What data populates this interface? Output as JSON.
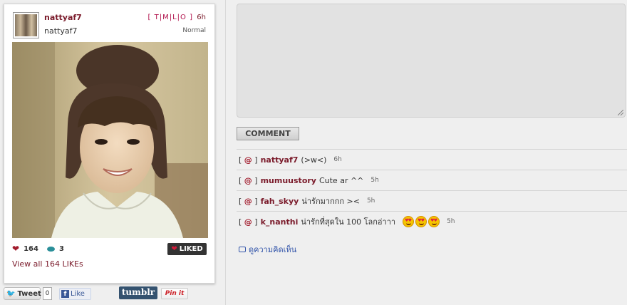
{
  "post": {
    "username": "nattyaf7",
    "display_name": "nattyaf7",
    "share_links": [
      "T",
      "M",
      "L",
      "O"
    ],
    "age": "6h",
    "filter": "Normal",
    "likes_count": "164",
    "comments_count": "3",
    "liked_label": "LIKED",
    "view_all_label": "View all 164 LIKEs"
  },
  "social": {
    "tweet_label": "Tweet",
    "tweet_count": "0",
    "fb_like_label": "Like",
    "tumblr_label": "tumblr",
    "pinit_label": "Pin it"
  },
  "comment_form": {
    "button_label": "COMMENT"
  },
  "comments": [
    {
      "at": "@",
      "user": "nattyaf7",
      "text": "(>w<)",
      "age": "6h"
    },
    {
      "at": "@",
      "user": "mumuustory",
      "text": "Cute ar ^^",
      "age": "5h"
    },
    {
      "at": "@",
      "user": "fah_skyy",
      "text": "น่ารักมากกก ><",
      "age": "5h"
    },
    {
      "at": "@",
      "user": "k_nanthi",
      "text": "น่ารักที่สุดใน 100 โลกอ่าาา",
      "age": "5h"
    }
  ],
  "see_comments_label": "ดูความคิดเห็น",
  "colors": {
    "accent": "#7a1a2a",
    "heart": "#a21b2c",
    "background": "#efefef"
  },
  "icons": [
    "heart-icon",
    "comment-bubble-icon",
    "twitter-bird-icon",
    "facebook-icon",
    "emoji-heart-eyes-icon",
    "speech-bubble-icon"
  ]
}
